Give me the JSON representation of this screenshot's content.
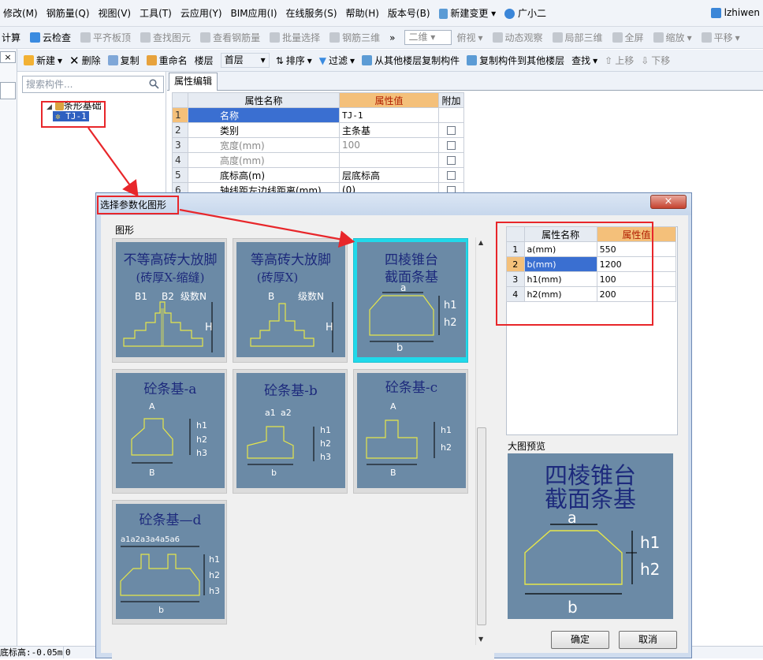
{
  "menu": [
    "修改(M)",
    "钢筋量(Q)",
    "视图(V)",
    "工具(T)",
    "云应用(Y)",
    "BIM应用(I)",
    "在线服务(S)",
    "帮助(H)",
    "版本号(B)",
    "新建变更 ▾",
    "广小二"
  ],
  "user": "lzhiwen",
  "toolbar1": {
    "items": [
      "计算",
      "云检查",
      "平齐板顶",
      "查找图元",
      "查看钢筋量",
      "批量选择",
      "钢筋三维"
    ],
    "more": "»",
    "view_mode": "二维",
    "items2": [
      "俯视",
      "动态观察",
      "局部三维",
      "全屏",
      "缩放",
      "平移"
    ]
  },
  "toolbar2": {
    "new": "新建",
    "delete": "删除",
    "copy": "复制",
    "rename": "重命名",
    "floor_label": "楼层",
    "floor_value": "首层",
    "sort": "排序",
    "filter": "过滤",
    "copy_from": "从其他楼层复制构件",
    "copy_to": "复制构件到其他楼层",
    "find": "查找",
    "up": "上移",
    "down": "下移"
  },
  "left": {
    "close": "×"
  },
  "tree": {
    "search_placeholder": "搜索构件...",
    "root": "条形基础",
    "child": "TJ-1"
  },
  "props": {
    "tab": "属性编辑",
    "headers": [
      "属性名称",
      "属性值",
      "附加"
    ],
    "rows": [
      {
        "num": "1",
        "name": "名称",
        "value": "TJ-1"
      },
      {
        "num": "2",
        "name": "类别",
        "value": "主条基"
      },
      {
        "num": "3",
        "name": "宽度(mm)",
        "value": "100"
      },
      {
        "num": "4",
        "name": "高度(mm)",
        "value": ""
      },
      {
        "num": "5",
        "name": "底标高(m)",
        "value": "层底标高"
      },
      {
        "num": "6",
        "name": "轴线距左边线距离(mm)",
        "value": "(0)"
      }
    ]
  },
  "status": {
    "elev": "底标高:-0.05m",
    "val": "0"
  },
  "dialog": {
    "title": "选择参数化图形",
    "close": "×",
    "group": "图形",
    "shapes": [
      {
        "title1": "不等高砖大放脚",
        "title2": "(砖厚X-缩缝)",
        "labels": [
          "B1",
          "B2",
          "级数N",
          "H"
        ]
      },
      {
        "title1": "等高砖大放脚",
        "title2": "(砖厚X)",
        "labels": [
          "B",
          "级数N",
          "H"
        ]
      },
      {
        "title1": "四棱锥台",
        "title2": "截面条基",
        "labels": [
          "a",
          "h1",
          "h2",
          "b"
        ]
      },
      {
        "title1": "砼条基-a",
        "labels": [
          "A",
          "h1",
          "h2",
          "h3",
          "B"
        ]
      },
      {
        "title1": "砼条基-b",
        "labels": [
          "a1",
          "a2",
          "h1",
          "h2",
          "h3",
          "b"
        ]
      },
      {
        "title1": "砼条基-c",
        "labels": [
          "A",
          "h1",
          "h2",
          "B"
        ]
      },
      {
        "title1": "砼条基—d",
        "labels": [
          "a1a2a3a4a5a6",
          "h1",
          "h2",
          "h3",
          "b"
        ]
      }
    ],
    "param_headers": [
      "属性名称",
      "属性值"
    ],
    "params": [
      {
        "num": "1",
        "name": "a(mm)",
        "value": "550"
      },
      {
        "num": "2",
        "name": "b(mm)",
        "value": "1200"
      },
      {
        "num": "3",
        "name": "h1(mm)",
        "value": "100"
      },
      {
        "num": "4",
        "name": "h2(mm)",
        "value": "200"
      }
    ],
    "preview_label": "大图预览",
    "preview": {
      "title1": "四棱锥台",
      "title2": "截面条基",
      "labels": [
        "a",
        "h1",
        "h2",
        "b"
      ]
    },
    "ok": "确定",
    "cancel": "取消"
  },
  "colors": {
    "tile_bg": "#6b8aa6",
    "shape_stroke": "#e6e64a",
    "title_text": "#1d2a7c",
    "annotation": "#e8262a",
    "selected_tile": "#20d9ea"
  }
}
